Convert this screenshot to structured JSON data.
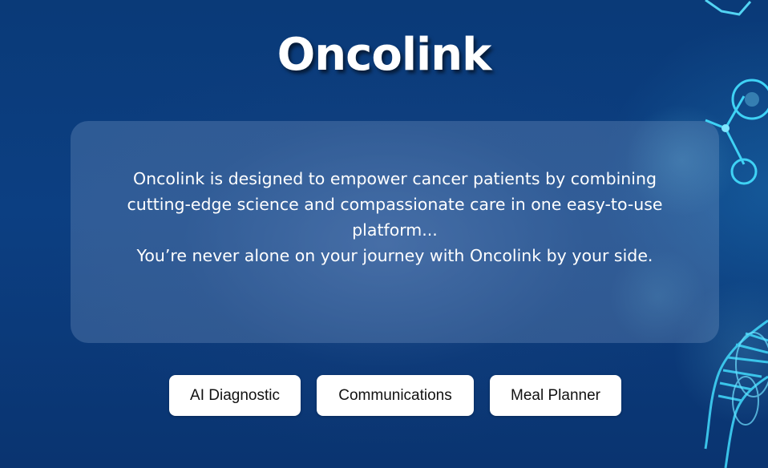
{
  "header": {
    "title": "Oncolink"
  },
  "intro": {
    "lines": [
      "Oncolink is designed to empower cancer patients by combining",
      "cutting-edge science and compassionate care in one easy-to-use",
      "platform...",
      "You’re never alone on your journey with Oncolink by your side."
    ]
  },
  "actions": {
    "ai_diagnostic_label": "AI Diagnostic",
    "communications_label": "Communications",
    "meal_planner_label": "Meal Planner"
  },
  "colors": {
    "background": "#0b3a7a",
    "card": "#7d9cc4",
    "button": "#ffffff",
    "decor_accent": "#3fd2f5"
  },
  "icons": {
    "background_decoration": "molecule-and-dna-helix"
  }
}
